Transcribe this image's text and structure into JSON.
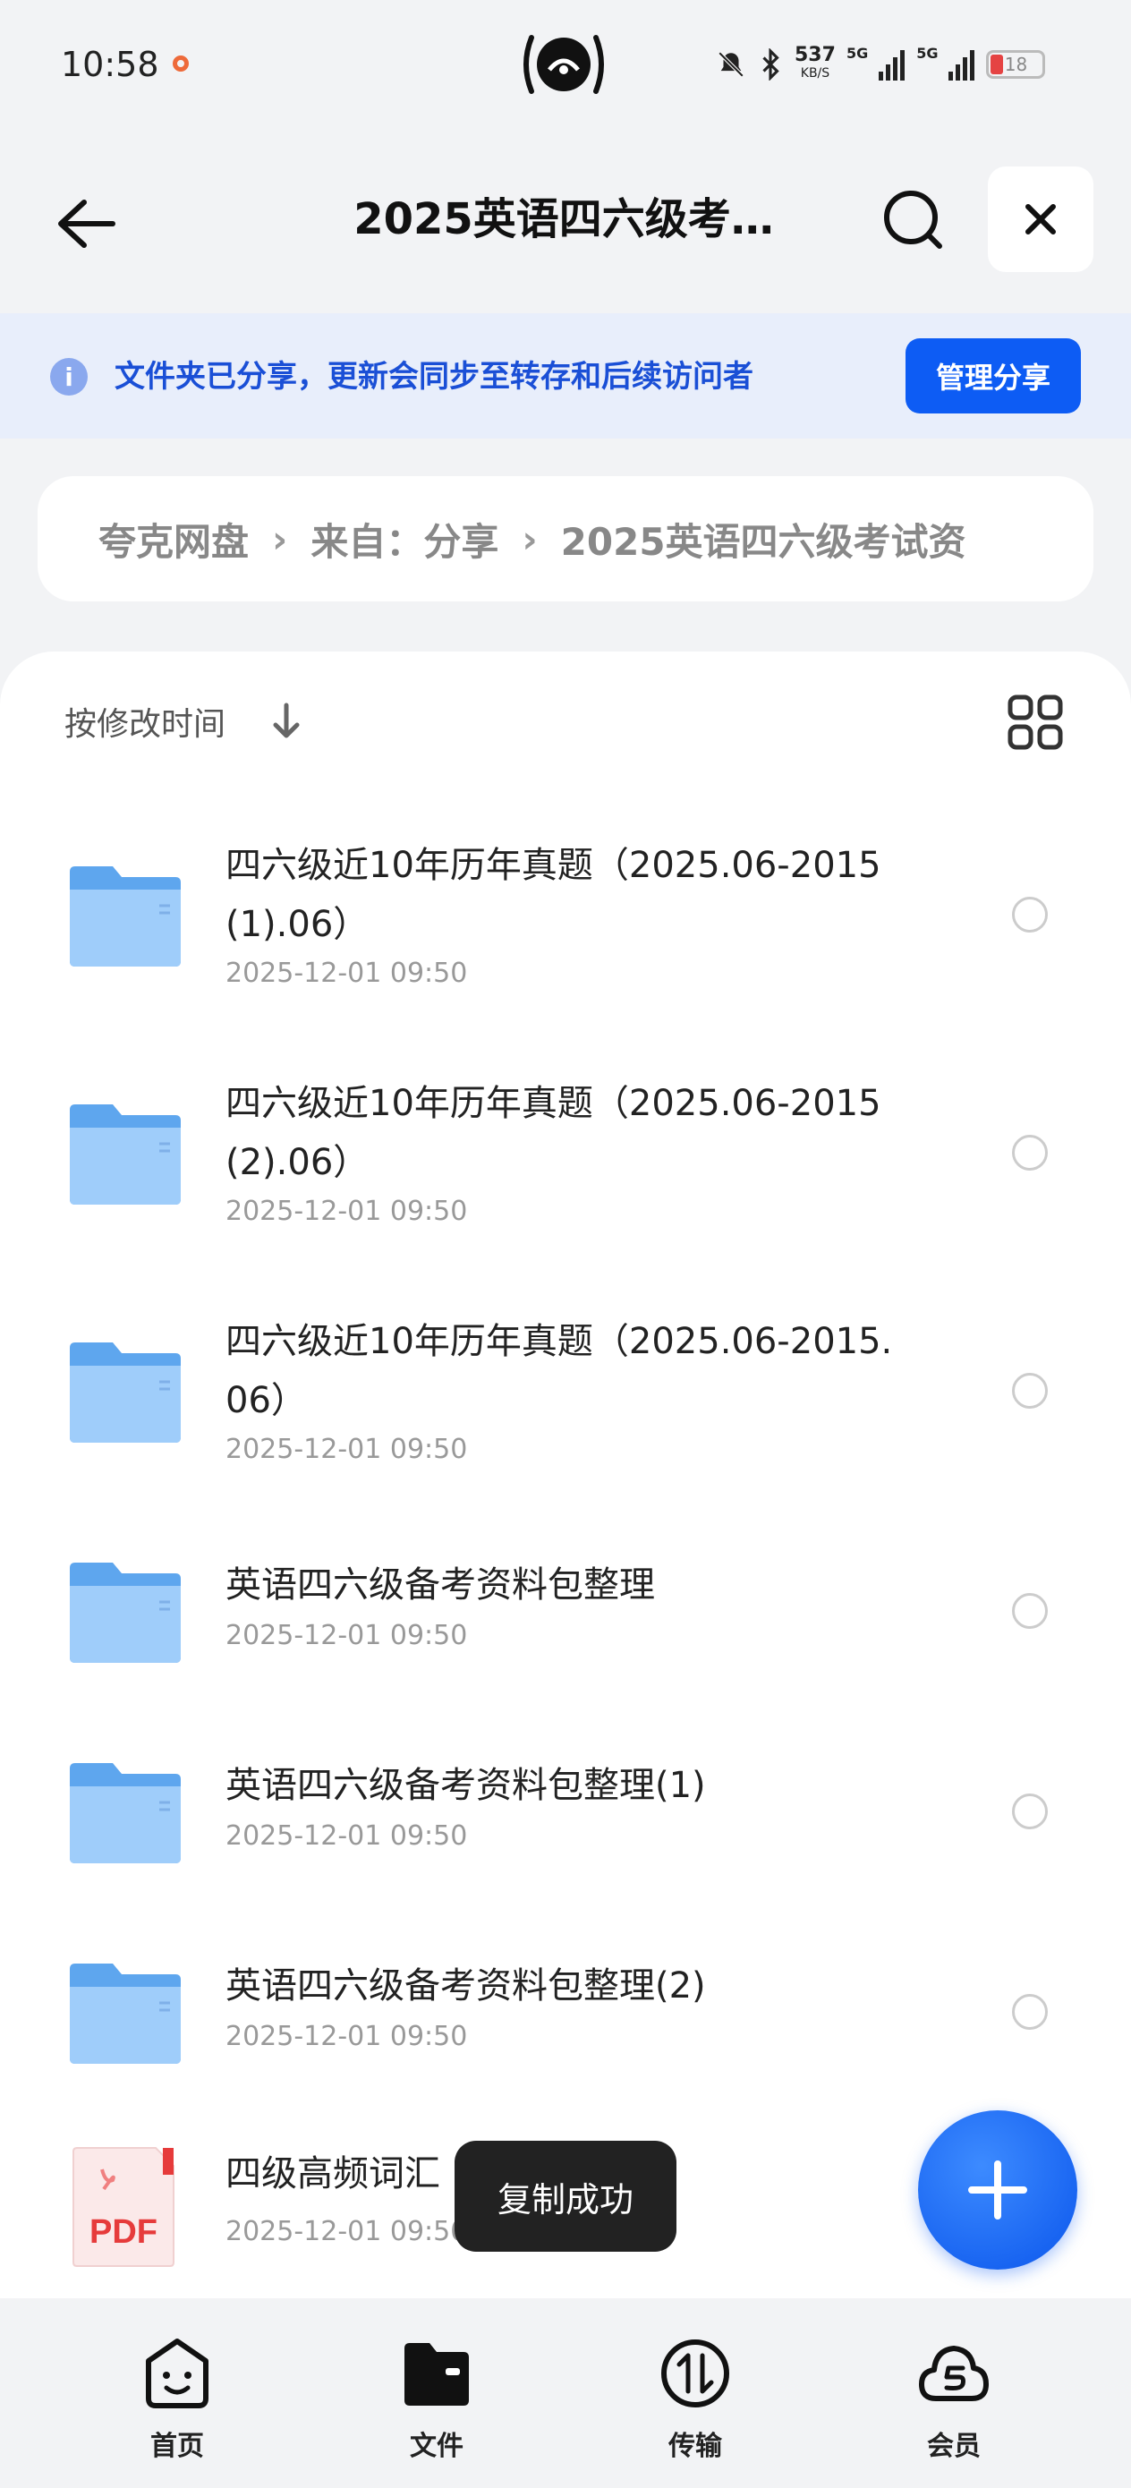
{
  "status_bar": {
    "time": "10:58",
    "net_speed": "537",
    "net_speed_unit": "KB/S",
    "sig1_label": "5G",
    "sig2_label": "5G",
    "battery": "18",
    "colors": {
      "record": "#ee6a3a",
      "battery_low": "#e54343"
    }
  },
  "header": {
    "title": "2025英语四六级考…"
  },
  "notice": {
    "text": "文件夹已分享，更新会同步至转存和后续访问者",
    "manage_label": "管理分享"
  },
  "breadcrumb": {
    "items": [
      "夸克网盘",
      "来自：分享",
      "2025英语四六级考试资"
    ]
  },
  "sort": {
    "label": "按修改时间"
  },
  "files": [
    {
      "name": "四六级近10年历年真题（2025.06-2015(1).06）",
      "date": "2025-12-01 09:50",
      "type": "folder"
    },
    {
      "name": "四六级近10年历年真题（2025.06-2015(2).06）",
      "date": "2025-12-01 09:50",
      "type": "folder"
    },
    {
      "name": "四六级近10年历年真题（2025.06-2015.06）",
      "date": "2025-12-01 09:50",
      "type": "folder"
    },
    {
      "name": "英语四六级备考资料包整理",
      "date": "2025-12-01 09:50",
      "type": "folder"
    },
    {
      "name": "英语四六级备考资料包整理(1)",
      "date": "2025-12-01 09:50",
      "type": "folder"
    },
    {
      "name": "英语四六级备考资料包整理(2)",
      "date": "2025-12-01 09:50",
      "type": "folder"
    },
    {
      "name": "四级高频词汇",
      "date": "2025-12-01 09:50",
      "type": "pdf",
      "icon_label": "PDF"
    }
  ],
  "toast": {
    "text": "复制成功"
  },
  "bottom_nav": [
    {
      "label": "首页",
      "icon": "home-face-icon"
    },
    {
      "label": "文件",
      "icon": "folder-icon"
    },
    {
      "label": "传输",
      "icon": "transfer-icon"
    },
    {
      "label": "会员",
      "icon": "cloud-member-icon"
    }
  ],
  "colors": {
    "accent": "#0d5cf4",
    "notice_bg": "#e8eefb",
    "folder": "#7fb6f5"
  }
}
